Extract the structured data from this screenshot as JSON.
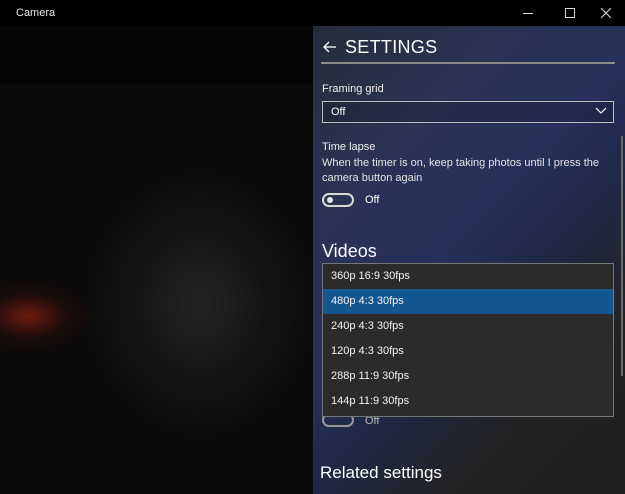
{
  "window": {
    "title": "Camera"
  },
  "panel": {
    "header": {
      "title": "SETTINGS"
    },
    "framing_grid": {
      "label": "Framing grid",
      "value": "Off"
    },
    "time_lapse": {
      "label": "Time lapse",
      "description": "When the timer is on, keep taking photos until I press the camera button again",
      "toggle_state": "Off"
    },
    "videos": {
      "title": "Videos",
      "options": [
        "360p 16:9 30fps",
        "480p 4:3 30fps",
        "240p 4:3 30fps",
        "120p 4:3 30fps",
        "288p 11:9 30fps",
        "144p 11:9 30fps"
      ],
      "selected": "480p 4:3 30fps",
      "toggle_state": "Off"
    },
    "related": {
      "title": "Related settings"
    }
  },
  "colors": {
    "selection": "#14568f",
    "panel_accent": "#26305a"
  }
}
